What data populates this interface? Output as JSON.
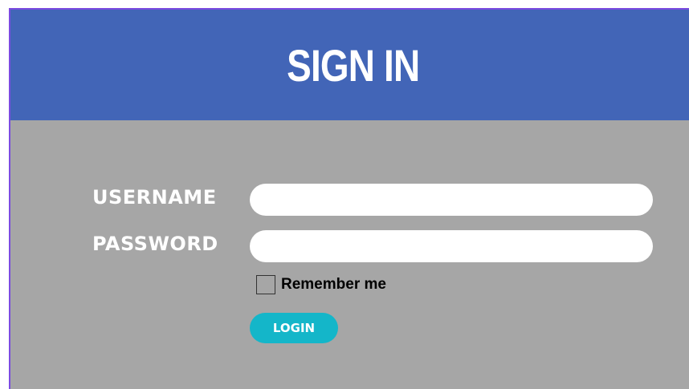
{
  "header": {
    "title": "SIGN IN"
  },
  "form": {
    "username_label": "USERNAME",
    "username_value": "",
    "password_label": "PASSWORD",
    "password_value": "",
    "remember_label": "Remember me",
    "remember_checked": false,
    "login_label": "LOGIN"
  },
  "colors": {
    "header_bg": "#4265b7",
    "body_bg": "#a6a6a6",
    "button_bg": "#14b6c9",
    "frame_border": "#7b4be0"
  }
}
